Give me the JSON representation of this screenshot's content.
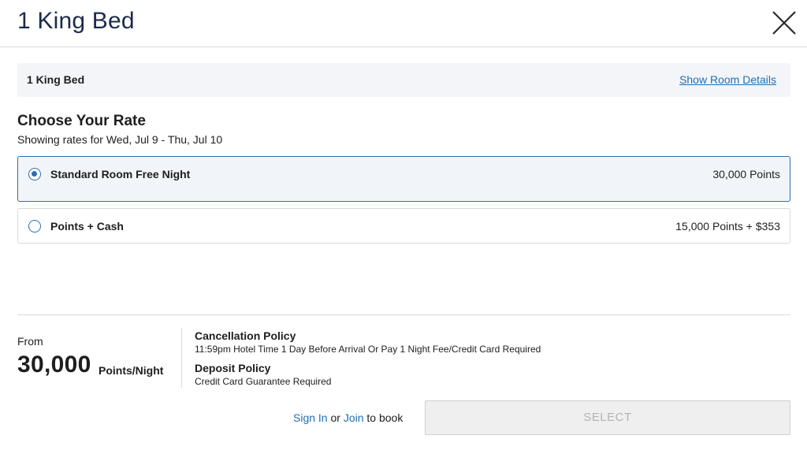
{
  "header": {
    "title": "1 King Bed",
    "close_icon": "close-icon"
  },
  "room_bar": {
    "name": "1 King Bed",
    "details_link": "Show Room Details"
  },
  "rate_section": {
    "title": "Choose Your Rate",
    "subtitle": "Showing rates for Wed, Jul 9 - Thu, Jul 10",
    "options": [
      {
        "label": "Standard Room Free Night",
        "price": "30,000 Points",
        "selected": true
      },
      {
        "label": "Points + Cash",
        "price": "15,000 Points + $353",
        "selected": false
      }
    ]
  },
  "summary": {
    "from_label": "From",
    "price": "30,000",
    "price_unit": "Points/Night",
    "cancellation_title": "Cancellation Policy",
    "cancellation_text": "11:59pm Hotel Time 1 Day Before Arrival Or Pay 1 Night Fee/Credit Card Required",
    "deposit_title": "Deposit Policy",
    "deposit_text": "Credit Card Guarantee Required"
  },
  "footer": {
    "sign_in": "Sign In",
    "or": " or ",
    "join": "Join",
    "to_book": " to book",
    "select_label": "SELECT"
  },
  "colors": {
    "accent": "#2f6db3",
    "link": "#1f6fb5",
    "title": "#1c2b4a"
  }
}
